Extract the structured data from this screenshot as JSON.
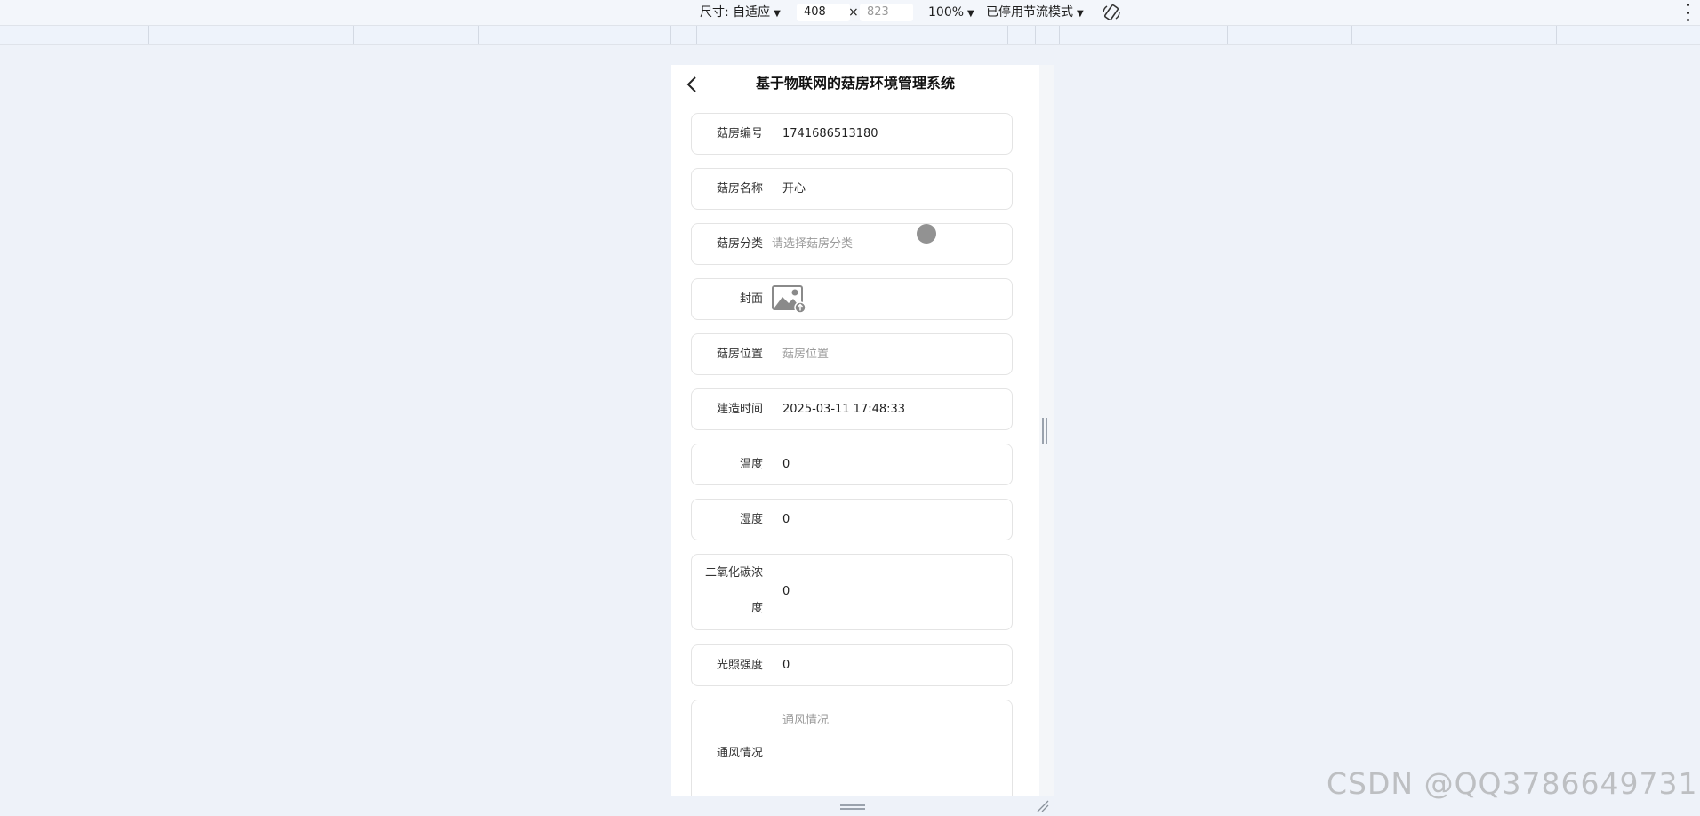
{
  "devtools": {
    "dimensions_label": "尺寸: 自适应",
    "width_value": "408",
    "times_sign": "×",
    "height_placeholder": "823",
    "zoom_label": "100%",
    "throttle_label": "已停用节流模式",
    "icons": [
      "chevron-down-icon",
      "rotate-icon",
      "kebab-menu-icon"
    ]
  },
  "app": {
    "title": "基于物联网的菇房环境管理系统",
    "back_icon": "back-arrow-icon",
    "form": {
      "room_number": {
        "label": "菇房编号",
        "value": "1741686513180"
      },
      "room_name": {
        "label": "菇房名称",
        "value": "开心"
      },
      "room_category": {
        "label": "菇房分类",
        "placeholder": "请选择菇房分类"
      },
      "cover": {
        "label": "封面",
        "icon": "image-upload-icon"
      },
      "location": {
        "label": "菇房位置",
        "placeholder": "菇房位置"
      },
      "build_time": {
        "label": "建造时间",
        "value": "2025-03-11 17:48:33"
      },
      "temperature": {
        "label": "温度",
        "value": "0"
      },
      "humidity": {
        "label": "湿度",
        "value": "0"
      },
      "co2": {
        "label_line1": "二氧化碳浓",
        "label_line2": "度",
        "value": "0"
      },
      "light": {
        "label": "光照强度",
        "value": "0"
      },
      "ventilation": {
        "label": "通风情况",
        "placeholder": "通风情况"
      }
    }
  },
  "watermark": "CSDN @QQ3786649731",
  "colors": {
    "page_bg": "#eef2f9",
    "card_border": "#e4e4e4",
    "placeholder": "#9a9a9a"
  }
}
